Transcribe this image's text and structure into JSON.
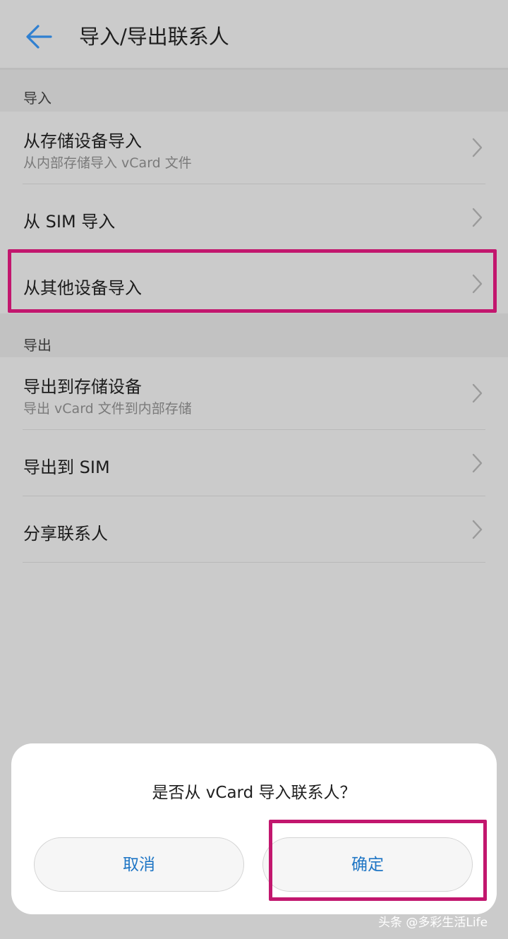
{
  "header": {
    "title": "导入/导出联系人",
    "back_icon": "arrow-left-icon",
    "accent_color": "#2f80d1"
  },
  "import_section": {
    "label": "导入",
    "items": [
      {
        "title": "从存储设备导入",
        "subtitle": "从内部存储导入 vCard 文件"
      },
      {
        "title": "从 SIM 导入"
      },
      {
        "title": "从其他设备导入"
      }
    ]
  },
  "export_section": {
    "label": "导出",
    "items": [
      {
        "title": "导出到存储设备",
        "subtitle": "导出 vCard 文件到内部存储"
      },
      {
        "title": "导出到 SIM"
      },
      {
        "title": "分享联系人"
      }
    ]
  },
  "dialog": {
    "message": "是否从 vCard 导入联系人？",
    "cancel_label": "取消",
    "confirm_label": "确定",
    "button_text_color": "#1f76c5"
  },
  "highlight_color": "#c2176e",
  "watermark": "头条 @多彩生活Life"
}
